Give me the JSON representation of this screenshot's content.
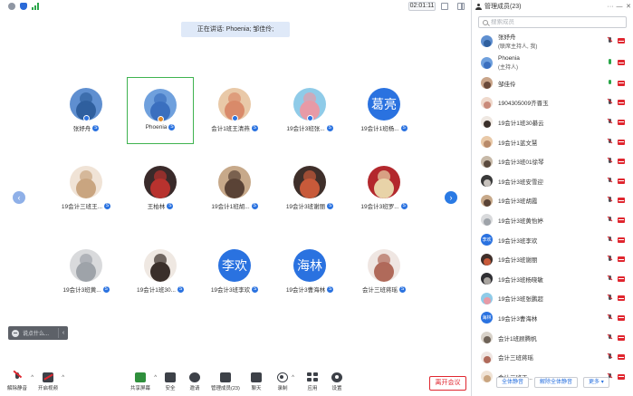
{
  "topbar": {
    "timer": "02:01:11"
  },
  "speaking_banner": "正在讲话: Phoenia; 邹佳伶;",
  "grid": {
    "tiles": [
      {
        "name": "张妤舟",
        "avatar_text": "",
        "avatar_colors": [
          "#5f8fd0",
          "#2f5f9e"
        ],
        "active": false,
        "badge_color": "#2a72e0"
      },
      {
        "name": "Phoenia",
        "avatar_text": "",
        "avatar_colors": [
          "#6fa0dd",
          "#3a6fbf"
        ],
        "active": true,
        "badge_color": "#e08a2a"
      },
      {
        "name": "会计1班王清燕",
        "avatar_text": "",
        "avatar_colors": [
          "#e9c9a8",
          "#d98a6a"
        ],
        "active": false,
        "badge_color": "#2a72e0"
      },
      {
        "name": "19会计3班张...",
        "avatar_text": "",
        "avatar_colors": [
          "#8fcbe8",
          "#e79aa6"
        ],
        "active": false,
        "badge_color": "#2a72e0"
      },
      {
        "name": "19会计1班杨...",
        "avatar_text": "葛亮",
        "avatar_colors": [
          "#2a72e0",
          "#2a72e0"
        ],
        "active": false,
        "badge_color": ""
      },
      {
        "name": "19会计三班王...",
        "avatar_text": "",
        "avatar_colors": [
          "#f0e3d6",
          "#c9a580"
        ],
        "active": false,
        "badge_color": ""
      },
      {
        "name": "王柏林",
        "avatar_text": "",
        "avatar_colors": [
          "#3a2a2a",
          "#b8322e"
        ],
        "active": false,
        "badge_color": ""
      },
      {
        "name": "19会计1班胡...",
        "avatar_text": "",
        "avatar_colors": [
          "#c7a98a",
          "#5a4336"
        ],
        "active": false,
        "badge_color": ""
      },
      {
        "name": "19会计3班谢丽",
        "avatar_text": "",
        "avatar_colors": [
          "#3f2f2a",
          "#c85a3a"
        ],
        "active": false,
        "badge_color": ""
      },
      {
        "name": "19会计3班罗...",
        "avatar_text": "",
        "avatar_colors": [
          "#b3282d",
          "#e8d3a8"
        ],
        "active": false,
        "badge_color": ""
      },
      {
        "name": "19会计3班黄...",
        "avatar_text": "",
        "avatar_colors": [
          "#d9dadc",
          "#9ea3a9"
        ],
        "active": false,
        "badge_color": ""
      },
      {
        "name": "19会计1班30...",
        "avatar_text": "",
        "avatar_colors": [
          "#efe8e2",
          "#3a2f2a"
        ],
        "active": false,
        "badge_color": ""
      },
      {
        "name": "19会计3班李欢",
        "avatar_text": "李欢",
        "avatar_colors": [
          "#2a72e0",
          "#2a72e0"
        ],
        "active": false,
        "badge_color": ""
      },
      {
        "name": "19会计3曹海林",
        "avatar_text": "海林",
        "avatar_colors": [
          "#2a72e0",
          "#2a72e0"
        ],
        "active": false,
        "badge_color": ""
      },
      {
        "name": "会计三班蒋瑶",
        "avatar_text": "",
        "avatar_colors": [
          "#efe6e2",
          "#b06a5a"
        ],
        "active": false,
        "badge_color": ""
      }
    ]
  },
  "chat": {
    "placeholder": "说点什么..."
  },
  "toolbar": {
    "unmute": "解除静音",
    "start_video": "开启视频",
    "share_screen": "共享屏幕",
    "security": "安全",
    "invite": "邀请",
    "manage_members": "管理成员(23)",
    "chat": "聊天",
    "record": "录制",
    "apps": "应用",
    "settings": "设置",
    "leave": "离开会议"
  },
  "panel": {
    "title": "管理成员(23)",
    "search_placeholder": "搜索成员",
    "members": [
      {
        "name": "张妤舟",
        "sub": "(联席主持人, 我)",
        "avatar_text": "",
        "avatar_colors": [
          "#5f8fd0",
          "#2f5f9e"
        ],
        "mic_on": false
      },
      {
        "name": "Phoenia",
        "sub": "(主持人)",
        "avatar_text": "",
        "avatar_colors": [
          "#6fa0dd",
          "#3a6fbf"
        ],
        "mic_on": true
      },
      {
        "name": "邹佳伶",
        "sub": "",
        "avatar_text": "",
        "avatar_colors": [
          "#c9a58a",
          "#6a4a3a"
        ],
        "mic_on": true
      },
      {
        "name": "1904305009齐晋玉",
        "sub": "",
        "avatar_text": "",
        "avatar_colors": [
          "#efd9cc",
          "#c98a7a"
        ],
        "mic_on": false
      },
      {
        "name": "19会计1班30綦云",
        "sub": "",
        "avatar_text": "",
        "avatar_colors": [
          "#efe8e2",
          "#3a2f2a"
        ],
        "mic_on": false
      },
      {
        "name": "19会计1蓝文慧",
        "sub": "",
        "avatar_text": "",
        "avatar_colors": [
          "#e9c9a8",
          "#b88a6a"
        ],
        "mic_on": false
      },
      {
        "name": "19会计3班01徐琴",
        "sub": "",
        "avatar_text": "",
        "avatar_colors": [
          "#c7b9a8",
          "#5a4a3e"
        ],
        "mic_on": false
      },
      {
        "name": "19会计3班安雪迎",
        "sub": "",
        "avatar_text": "",
        "avatar_colors": [
          "#3a3a3a",
          "#c7c2bd"
        ],
        "mic_on": false
      },
      {
        "name": "19会计3班胡霞",
        "sub": "",
        "avatar_text": "",
        "avatar_colors": [
          "#c7a98a",
          "#5a4336"
        ],
        "mic_on": false
      },
      {
        "name": "19会计3班黄怡婷",
        "sub": "",
        "avatar_text": "",
        "avatar_colors": [
          "#d9dadc",
          "#9ea3a9"
        ],
        "mic_on": false
      },
      {
        "name": "19会计3班李欢",
        "sub": "",
        "avatar_text": "李欢",
        "avatar_colors": [
          "#2a72e0",
          "#2a72e0"
        ],
        "mic_on": false
      },
      {
        "name": "19会计3班谢丽",
        "sub": "",
        "avatar_text": "",
        "avatar_colors": [
          "#3f2f2a",
          "#c85a3a"
        ],
        "mic_on": false
      },
      {
        "name": "19会计3班杨晓敏",
        "sub": "",
        "avatar_text": "",
        "avatar_colors": [
          "#2f2f33",
          "#a9a5a0"
        ],
        "mic_on": false
      },
      {
        "name": "19会计3班张鹏超",
        "sub": "",
        "avatar_text": "",
        "avatar_colors": [
          "#8fcbe8",
          "#e79aa6"
        ],
        "mic_on": false
      },
      {
        "name": "19会计3曹海林",
        "sub": "",
        "avatar_text": "海林",
        "avatar_colors": [
          "#2a72e0",
          "#2a72e0"
        ],
        "mic_on": false
      },
      {
        "name": "会计1班顾腾帆",
        "sub": "",
        "avatar_text": "",
        "avatar_colors": [
          "#d8d2c9",
          "#6e6358"
        ],
        "mic_on": false
      },
      {
        "name": "会计三班蒋瑶",
        "sub": "",
        "avatar_text": "",
        "avatar_colors": [
          "#efe6e2",
          "#b06a5a"
        ],
        "mic_on": false
      },
      {
        "name": "会计三班王...",
        "sub": "",
        "avatar_text": "",
        "avatar_colors": [
          "#f0e3d6",
          "#c9a580"
        ],
        "mic_on": false
      }
    ],
    "row_action": "指4",
    "footer": {
      "mute_all": "全体静音",
      "unmute_all": "解除全体静音",
      "more": "更多 ▾"
    }
  },
  "colors": {
    "accent": "#2a72e0",
    "danger": "#e0262f",
    "success": "#2aa64a"
  }
}
